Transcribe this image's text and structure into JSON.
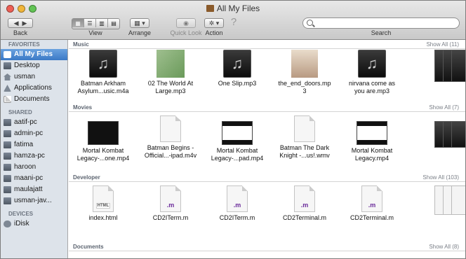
{
  "window": {
    "title": "All My Files"
  },
  "toolbar": {
    "back_label": "Back",
    "view_label": "View",
    "arrange_label": "Arrange",
    "quicklook_label": "Quick Look",
    "action_label": "Action",
    "help_glyph": "?",
    "search_label": "Search",
    "search_placeholder": ""
  },
  "sidebar": {
    "favorites_header": "FAVORITES",
    "favorites": [
      {
        "label": "All My Files",
        "icon": "all-files-icon",
        "selected": true
      },
      {
        "label": "Desktop",
        "icon": "desktop-icon"
      },
      {
        "label": "usman",
        "icon": "home-icon"
      },
      {
        "label": "Applications",
        "icon": "applications-icon"
      },
      {
        "label": "Documents",
        "icon": "documents-icon"
      }
    ],
    "shared_header": "SHARED",
    "shared": [
      {
        "label": "aatif-pc"
      },
      {
        "label": "admin-pc"
      },
      {
        "label": "fatima"
      },
      {
        "label": "hamza-pc"
      },
      {
        "label": "haroon"
      },
      {
        "label": "maani-pc"
      },
      {
        "label": "maulajatt"
      },
      {
        "label": "usman-jav..."
      }
    ],
    "devices_header": "DEVICES",
    "devices": [
      {
        "label": "iDisk"
      }
    ]
  },
  "sections": {
    "music": {
      "title": "Music",
      "show_all": "Show All (11)",
      "items": [
        {
          "l1": "Batman Arkham",
          "l2": "Asylum...usic.m4a"
        },
        {
          "l1": "02 The World At",
          "l2": "Large.mp3"
        },
        {
          "l1": "One Slip.mp3",
          "l2": ""
        },
        {
          "l1": "the_end_doors.mp",
          "l2": "3"
        },
        {
          "l1": "nirvana come as",
          "l2": "you are.mp3"
        }
      ]
    },
    "movies": {
      "title": "Movies",
      "show_all": "Show All (7)",
      "items": [
        {
          "l1": "Mortal Kombat",
          "l2": "Legacy-...one.mp4"
        },
        {
          "l1": "Batman Begins -",
          "l2": "Official...-ipad.m4v"
        },
        {
          "l1": "Mortal Kombat",
          "l2": "Legacy-...pad.mp4"
        },
        {
          "l1": "Batman The Dark",
          "l2": "Knight -...us!.wmv"
        },
        {
          "l1": "Mortal Kombat",
          "l2": "Legacy.mp4"
        }
      ]
    },
    "developer": {
      "title": "Developer",
      "show_all": "Show All (103)",
      "items": [
        {
          "l1": "index.html",
          "l2": "",
          "ext": "HTML"
        },
        {
          "l1": "CD2ITerm.m",
          "l2": "",
          "ext": ".m"
        },
        {
          "l1": "CD2ITerm.m",
          "l2": "",
          "ext": ".m"
        },
        {
          "l1": "CD2Terminal.m",
          "l2": "",
          "ext": ".m"
        },
        {
          "l1": "CD2Terminal.m",
          "l2": "",
          "ext": ".m"
        }
      ]
    },
    "documents": {
      "title": "Documents",
      "show_all": "Show All (8)"
    }
  },
  "colors": {
    "selection": "#3a79c6",
    "sidebar_bg": "#dde3ea",
    "dev_ext": "#6a2a9a"
  }
}
